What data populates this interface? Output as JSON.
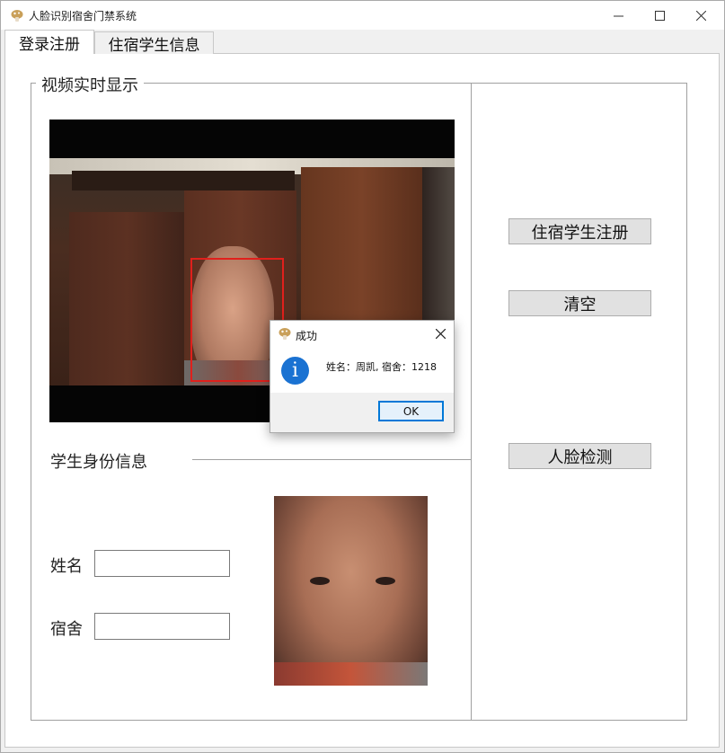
{
  "window": {
    "title": "人脸识别宿舍门禁系统"
  },
  "tabs": [
    {
      "label": "登录注册",
      "active": true
    },
    {
      "label": "住宿学生信息",
      "active": false
    }
  ],
  "video_section": {
    "label": "视频实时显示"
  },
  "identity_section": {
    "label": "学生身份信息"
  },
  "form": {
    "name_label": "姓名",
    "name_value": "",
    "dorm_label": "宿舍",
    "dorm_value": ""
  },
  "buttons": {
    "register": "住宿学生注册",
    "clear": "清空",
    "detect": "人脸检测"
  },
  "dialog": {
    "title": "成功",
    "message": "姓名：周凯, 宿舍：1218",
    "ok": "OK"
  },
  "icons": {
    "app": "mushroom-icon",
    "info": "info-icon"
  },
  "colors": {
    "face_box": "#e0201c",
    "info_blue": "#1a72d2",
    "ok_border": "#0078d7"
  }
}
